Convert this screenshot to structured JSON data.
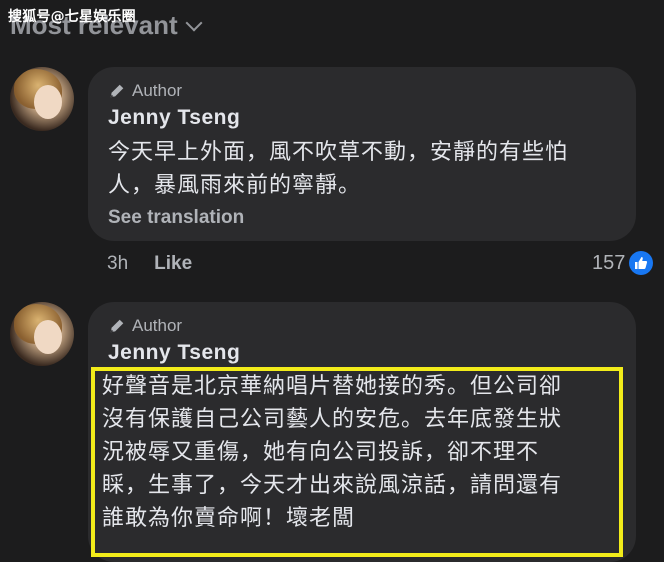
{
  "watermark": "搜狐号@七星娱乐圈",
  "sort": {
    "label": "Most relevant"
  },
  "comments": [
    {
      "badge": "Author",
      "name": "Jenny Tseng",
      "lines": [
        "今天早上外面，風不吹草不動，安靜的有些怕",
        "人，暴風雨來前的寧靜。"
      ],
      "see_translation": "See translation",
      "time": "3h",
      "like_label": "Like",
      "reaction_count": "157"
    },
    {
      "badge": "Author",
      "name": "Jenny Tseng",
      "lines": [
        "好聲音是北京華納唱片替她接的秀。但公司卻",
        "沒有保護自己公司藝人的安危。去年底發生狀",
        "況被辱又重傷，她有向公司投訴，卻不理不",
        "睬，生事了，今天才出來說風涼話，請問還有",
        "誰敢為你賣命啊！壞老闆"
      ]
    }
  ],
  "colors": {
    "background": "#1c1c1d",
    "bubble": "#2b2b2d",
    "highlight": "#f2ec1a",
    "like_blue": "#1877f2"
  },
  "icons": [
    "chevron-down-icon",
    "pen-icon",
    "thumbs-up-icon",
    "avatar"
  ]
}
